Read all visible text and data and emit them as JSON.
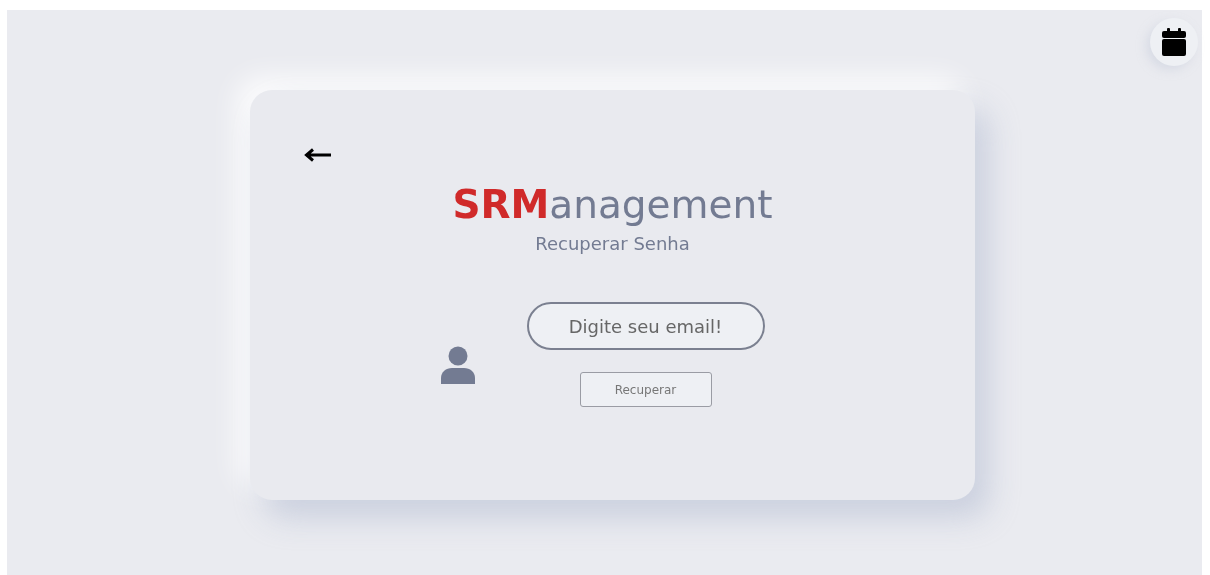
{
  "header": {
    "logo": "**SRM**anagement",
    "subtitle": "Recuperar Senha"
  },
  "form": {
    "email": {
      "placeholder": "Digite seu email!"
    },
    "submit": "Recuperar"
  }
}
